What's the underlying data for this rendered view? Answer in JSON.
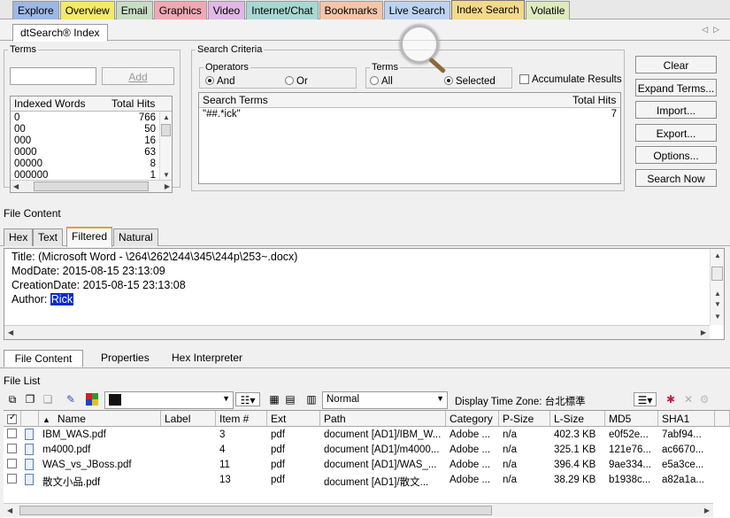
{
  "category_tabs": [
    {
      "label": "Explore",
      "color": "#9db8e6"
    },
    {
      "label": "Overview",
      "color": "#f3ea6a"
    },
    {
      "label": "Email",
      "color": "#c9dcc4"
    },
    {
      "label": "Graphics",
      "color": "#f2a8b4"
    },
    {
      "label": "Video",
      "color": "#e2b8e6"
    },
    {
      "label": "Internet/Chat",
      "color": "#a8d8d4"
    },
    {
      "label": "Bookmarks",
      "color": "#f6c4a8"
    },
    {
      "label": "Live Search",
      "color": "#bcd4f2"
    },
    {
      "label": "Index Search",
      "color": "#f3d98a"
    },
    {
      "label": "Volatile",
      "color": "#dfeabf"
    }
  ],
  "index_tab": "dtSearch® Index",
  "terms": {
    "legend": "Terms",
    "input_value": "",
    "add_label": "Add",
    "columns": [
      "Indexed Words",
      "Total Hits"
    ],
    "rows": [
      {
        "word": "0",
        "hits": "766"
      },
      {
        "word": "00",
        "hits": "50"
      },
      {
        "word": "000",
        "hits": "16"
      },
      {
        "word": "0000",
        "hits": "63"
      },
      {
        "word": "00000",
        "hits": "8"
      },
      {
        "word": "000000",
        "hits": "1"
      }
    ]
  },
  "criteria": {
    "legend": "Search Criteria",
    "operators_legend": "Operators",
    "op_and": "And",
    "op_or": "Or",
    "terms_legend": "Terms",
    "terms_all": "All",
    "terms_selected": "Selected",
    "accumulate": "Accumulate Results",
    "columns": [
      "Search Terms",
      "Total Hits"
    ],
    "rows": [
      {
        "term": "\"##.*ick\"",
        "hits": "7"
      }
    ]
  },
  "buttons": {
    "clear": "Clear",
    "expand": "Expand Terms...",
    "import": "Import...",
    "export": "Export...",
    "options": "Options...",
    "search": "Search Now"
  },
  "file_content": {
    "title": "File Content",
    "tabs": [
      "Hex",
      "Text",
      "Filtered",
      "Natural"
    ],
    "active_tab": "Filtered",
    "lines": {
      "title": "Title: (Microsoft Word - \\264\\262\\244\\345\\244p\\253~.docx)",
      "moddate": "ModDate: 2015-08-15 23:13:09",
      "creationdate": "CreationDate: 2015-08-15 23:13:08",
      "author_label": "Author: ",
      "author_value": "Rick"
    },
    "sub_tabs": [
      "File Content",
      "Properties",
      "Hex Interpreter"
    ]
  },
  "file_list": {
    "title": "File List",
    "view_mode": "Normal",
    "timezone_label": "Display Time Zone: 台北標準",
    "columns": [
      "Name",
      "Label",
      "Item #",
      "Ext",
      "Path",
      "Category",
      "P-Size",
      "L-Size",
      "MD5",
      "SHA1"
    ],
    "rows": [
      {
        "name": "IBM_WAS.pdf",
        "label": "",
        "item": "3",
        "ext": "pdf",
        "path": "document [AD1]/IBM_W...",
        "category": "Adobe ...",
        "psize": "n/a",
        "lsize": "402.3 KB",
        "md5": "e0f52e...",
        "sha1": "7abf94..."
      },
      {
        "name": "m4000.pdf",
        "label": "",
        "item": "4",
        "ext": "pdf",
        "path": "document [AD1]/m4000...",
        "category": "Adobe ...",
        "psize": "n/a",
        "lsize": "325.1 KB",
        "md5": "121e76...",
        "sha1": "ac6670..."
      },
      {
        "name": "WAS_vs_JBoss.pdf",
        "label": "",
        "item": "11",
        "ext": "pdf",
        "path": "document [AD1]/WAS_...",
        "category": "Adobe ...",
        "psize": "n/a",
        "lsize": "396.4 KB",
        "md5": "9ae334...",
        "sha1": "e5a3ce..."
      },
      {
        "name": "散文小品.pdf",
        "label": "",
        "item": "13",
        "ext": "pdf",
        "path": "document [AD1]/散文...",
        "category": "Adobe ...",
        "psize": "n/a",
        "lsize": "38.29 KB",
        "md5": "b1938c...",
        "sha1": "a82a1a..."
      }
    ]
  }
}
